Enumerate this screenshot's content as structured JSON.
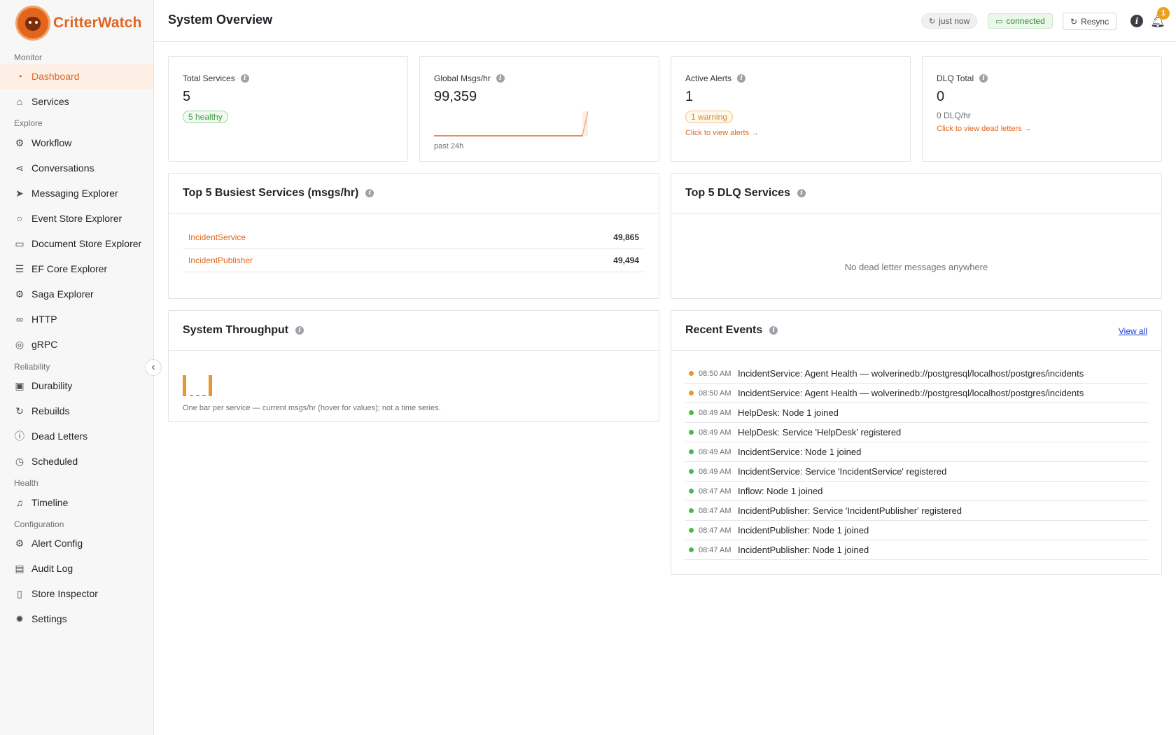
{
  "app": {
    "name": "CritterWatch"
  },
  "sidebar": {
    "groups": {
      "monitor": "Monitor",
      "explore": "Explore",
      "reliability": "Reliability",
      "health": "Health",
      "configuration": "Configuration"
    },
    "items": [
      {
        "label": "Dashboard",
        "icon": "dashboard-icon"
      },
      {
        "label": "Services",
        "icon": "home-icon"
      },
      {
        "label": "Workflow",
        "icon": "workflow-icon"
      },
      {
        "label": "Conversations",
        "icon": "share-icon"
      },
      {
        "label": "Messaging Explorer",
        "icon": "send-icon"
      },
      {
        "label": "Event Store Explorer",
        "icon": "search-icon"
      },
      {
        "label": "Document Store Explorer",
        "icon": "document-icon"
      },
      {
        "label": "EF Core Explorer",
        "icon": "file-text-icon"
      },
      {
        "label": "Saga Explorer",
        "icon": "workflow-icon"
      },
      {
        "label": "HTTP",
        "icon": "link-icon"
      },
      {
        "label": "gRPC",
        "icon": "layers-icon"
      },
      {
        "label": "Durability",
        "icon": "box-icon"
      },
      {
        "label": "Rebuilds",
        "icon": "refresh-icon"
      },
      {
        "label": "Dead Letters",
        "icon": "alert-circle-icon"
      },
      {
        "label": "Scheduled",
        "icon": "clock-icon"
      },
      {
        "label": "Timeline",
        "icon": "bell-icon"
      },
      {
        "label": "Alert Config",
        "icon": "gear-icon"
      },
      {
        "label": "Audit Log",
        "icon": "book-icon"
      },
      {
        "label": "Store Inspector",
        "icon": "file-icon"
      },
      {
        "label": "Settings",
        "icon": "cog-icon"
      }
    ]
  },
  "header": {
    "title": "System Overview",
    "last_update": "just now",
    "connection": "connected",
    "resync_label": "Resync",
    "notification_count": "1"
  },
  "stats": {
    "total_services": {
      "label": "Total Services",
      "value": "5",
      "badge": "5 healthy"
    },
    "global_msgs": {
      "label": "Global Msgs/hr",
      "value": "99,359",
      "caption": "past 24h"
    },
    "active_alerts": {
      "label": "Active Alerts",
      "value": "1",
      "badge": "1 warning",
      "link": "Click to view alerts →"
    },
    "dlq_total": {
      "label": "DLQ Total",
      "value": "0",
      "sub": "0 DLQ/hr",
      "link": "Click to view dead letters →"
    }
  },
  "busiest": {
    "title": "Top 5 Busiest Services (msgs/hr)",
    "rows": [
      {
        "name": "IncidentService",
        "value": "49,865"
      },
      {
        "name": "IncidentPublisher",
        "value": "49,494"
      }
    ]
  },
  "dlq_services": {
    "title": "Top 5 DLQ Services",
    "empty": "No dead letter messages anywhere"
  },
  "throughput": {
    "title": "System Throughput",
    "caption": "One bar per service — current msgs/hr (hover for values); not a time series."
  },
  "recent_events": {
    "title": "Recent Events",
    "view_all": "View all",
    "rows": [
      {
        "time": "08:50 AM",
        "text": "IncidentService: Agent Health — wolverinedb://postgresql/localhost/postgres/incidents",
        "level": "warning"
      },
      {
        "time": "08:50 AM",
        "text": "IncidentService: Agent Health — wolverinedb://postgresql/localhost/postgres/incidents",
        "level": "warning"
      },
      {
        "time": "08:49 AM",
        "text": "HelpDesk: Node 1 joined",
        "level": "ok"
      },
      {
        "time": "08:49 AM",
        "text": "HelpDesk: Service 'HelpDesk' registered",
        "level": "ok"
      },
      {
        "time": "08:49 AM",
        "text": "IncidentService: Node 1 joined",
        "level": "ok"
      },
      {
        "time": "08:49 AM",
        "text": "IncidentService: Service 'IncidentService' registered",
        "level": "ok"
      },
      {
        "time": "08:47 AM",
        "text": "Inflow: Node 1 joined",
        "level": "ok"
      },
      {
        "time": "08:47 AM",
        "text": "IncidentPublisher: Service 'IncidentPublisher' registered",
        "level": "ok"
      },
      {
        "time": "08:47 AM",
        "text": "IncidentPublisher: Node 1 joined",
        "level": "ok"
      },
      {
        "time": "08:47 AM",
        "text": "IncidentPublisher: Node 1 joined",
        "level": "ok"
      }
    ]
  },
  "colors": {
    "accent": "#e2651e",
    "warning": "#e8962e",
    "ok": "#4cb84c",
    "link": "#1a3fd6"
  }
}
